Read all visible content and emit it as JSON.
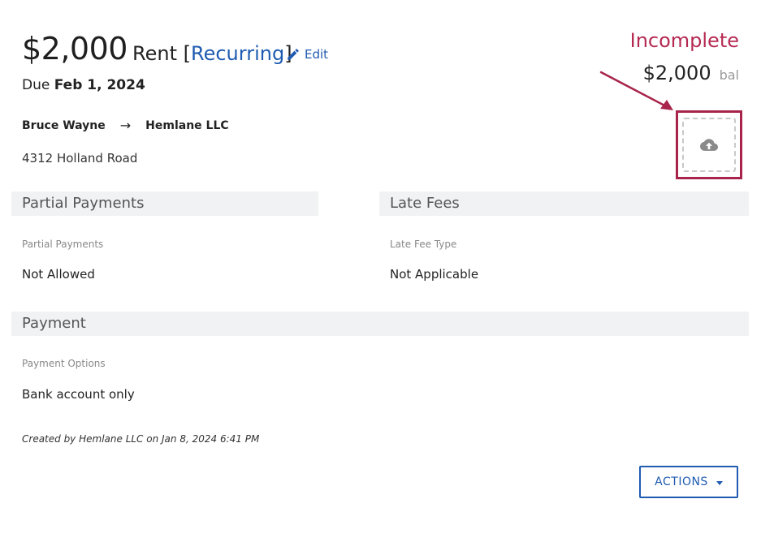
{
  "header": {
    "amount": "$2,000",
    "charge_name": "Rent",
    "bracket_open": "[",
    "recurring_label": "Recurring",
    "bracket_close": "]",
    "edit_label": "Edit",
    "due_prefix": "Due",
    "due_date": "Feb 1, 2024"
  },
  "parties": {
    "from": "Bruce Wayne",
    "arrow": "→",
    "to": "Hemlane LLC"
  },
  "property": {
    "address": "4312 Holland Road"
  },
  "status": {
    "label": "Incomplete",
    "balance_amount": "$2,000",
    "balance_suffix": "bal",
    "color": "#b52a52"
  },
  "upload": {
    "icon": "cloud-upload-icon"
  },
  "sections": {
    "partial_payments": {
      "title": "Partial Payments",
      "field_label": "Partial Payments",
      "field_value": "Not Allowed"
    },
    "late_fees": {
      "title": "Late Fees",
      "field_label": "Late Fee Type",
      "field_value": "Not Applicable"
    },
    "payment": {
      "title": "Payment",
      "field_label": "Payment Options",
      "field_value": "Bank account only"
    }
  },
  "footer": {
    "created_text": "Created by Hemlane LLC on Jan 8, 2024 6:41 PM",
    "actions_label": "ACTIONS"
  },
  "colors": {
    "accent": "#1f5bb0",
    "highlight": "#a8244a",
    "section_bg": "#f1f2f4"
  }
}
